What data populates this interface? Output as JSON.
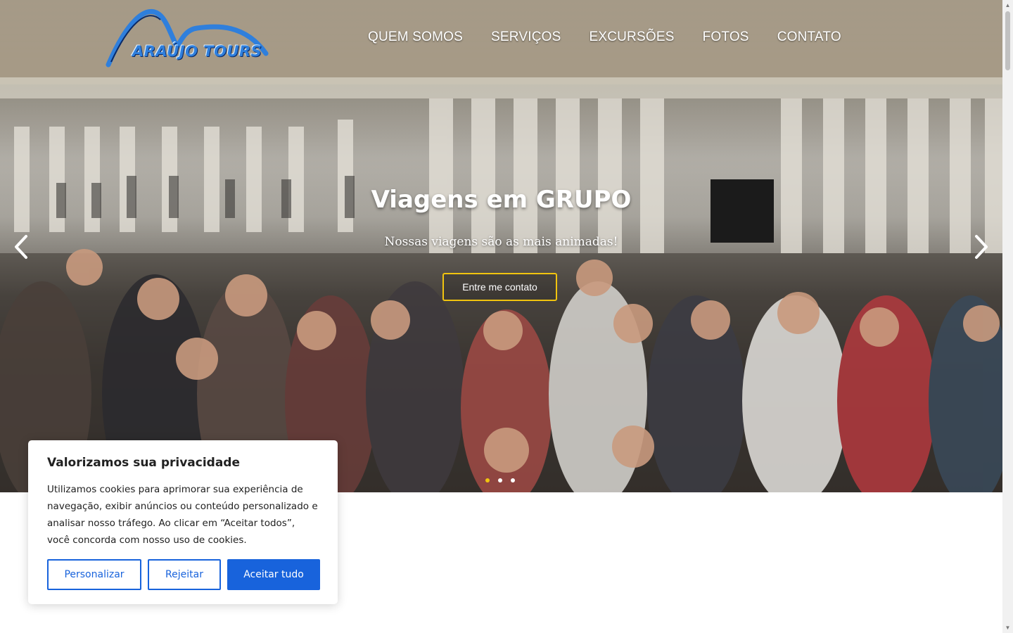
{
  "brand": {
    "logo_text": "ARAÚJO TOURS",
    "colors": {
      "logo_blue": "#2f7fdc",
      "accent_yellow": "#f1c40f",
      "cookie_blue": "#1863dc"
    }
  },
  "nav": {
    "items": [
      {
        "label": "QUEM SOMOS"
      },
      {
        "label": "SERVIÇOS"
      },
      {
        "label": "EXCURSÕES"
      },
      {
        "label": "FOTOS"
      },
      {
        "label": "CONTATO"
      }
    ]
  },
  "slider": {
    "title": "Viagens em GRUPO",
    "subtitle": "Nossas viagens são as mais animadas!",
    "cta_label": "Entre me contato",
    "prev_icon": "chevron-left-icon",
    "next_icon": "chevron-right-icon",
    "slide_count": 3,
    "active_slide": 1
  },
  "cookie": {
    "title": "Valorizamos sua privacidade",
    "body": "Utilizamos cookies para aprimorar sua experiência de navegação, exibir anúncios ou conteúdo personalizado e analisar nosso tráfego. Ao clicar em “Aceitar todos”, você concorda com nosso uso de cookies.",
    "customize_label": "Personalizar",
    "reject_label": "Rejeitar",
    "accept_label": "Aceitar tudo"
  }
}
